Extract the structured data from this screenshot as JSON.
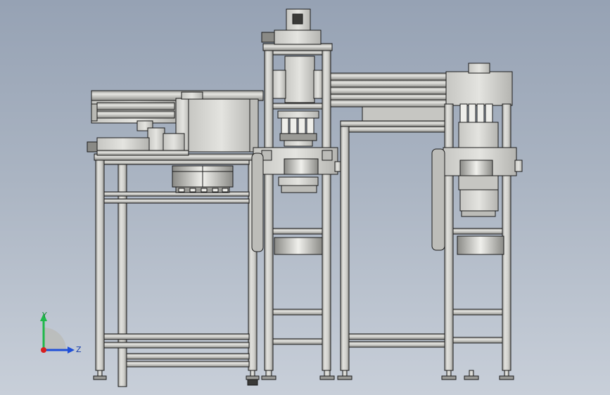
{
  "viewport": {
    "background_top": "#96a2b4",
    "background_bottom": "#c8cfd9",
    "model_stroke": "#1a1a1a",
    "model_fill": "#d3d3cf",
    "model_fill_dark": "#b9b9b4"
  },
  "triad": {
    "y_label": "Y",
    "z_label": "Z",
    "y_color": "#1fb84a",
    "z_color": "#1f4fd8",
    "x_color": "#d81f1f"
  }
}
